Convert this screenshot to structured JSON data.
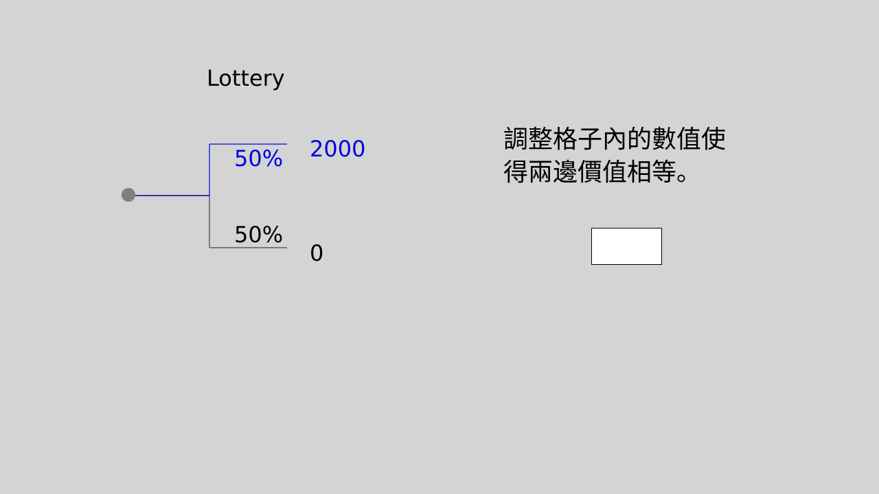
{
  "lottery": {
    "title": "Lottery",
    "branches": [
      {
        "probability": "50%",
        "outcome": "2000"
      },
      {
        "probability": "50%",
        "outcome": "0"
      }
    ]
  },
  "instruction": {
    "line1": "調整格子內的數值使",
    "line2": "得兩邊價值相等。"
  },
  "answer_input": {
    "value": ""
  },
  "colors": {
    "background": "#d4d4d4",
    "highlight": "#0000e0",
    "text": "#000000",
    "node": "#7f7f7f"
  }
}
